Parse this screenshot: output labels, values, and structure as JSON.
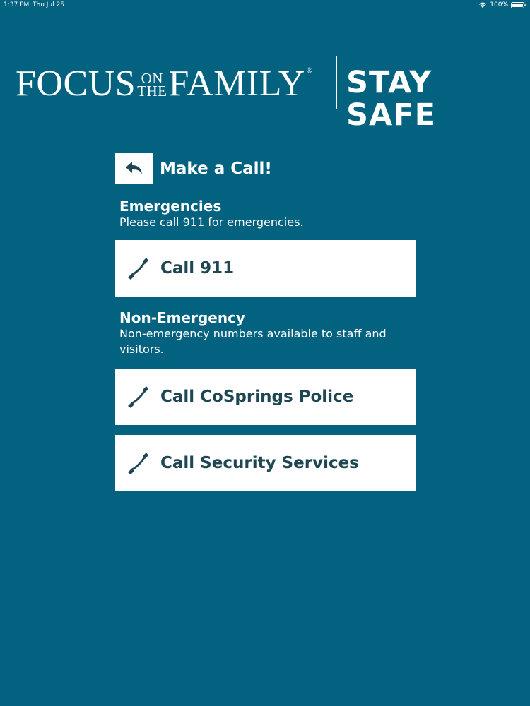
{
  "status_bar": {
    "time": "1:37 PM",
    "date": "Thu Jul 25",
    "battery": "100%",
    "icons": [
      "wifi-icon",
      "battery-icon"
    ]
  },
  "header": {
    "logo": {
      "focus": "FOCUS",
      "on": "ON",
      "the": "THE",
      "family": "FAMILY",
      "registered": "®",
      "app_name": "STAY SAFE"
    }
  },
  "page": {
    "title": "Make a Call!",
    "back_icon": "back-arrow-icon"
  },
  "emergencies": {
    "heading": "Emergencies",
    "description": "Please call 911 for emergencies.",
    "button_label": "Call 911"
  },
  "non_emergency": {
    "heading": "Non-Emergency",
    "description": "Non-emergency numbers available to staff and visitors.",
    "buttons": [
      {
        "label": "Call CoSprings Police"
      },
      {
        "label": "Call Security Services"
      }
    ]
  },
  "colors": {
    "background": "#03627f",
    "button_text": "#1e4653",
    "button_bg": "#ffffff"
  }
}
